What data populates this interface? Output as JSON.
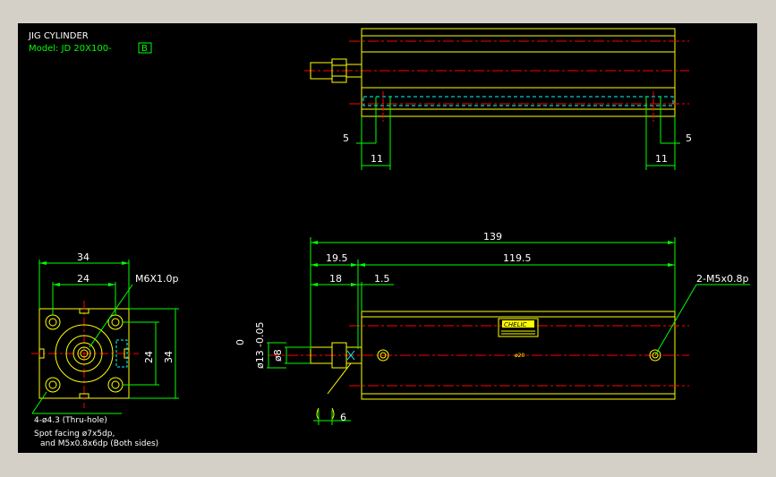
{
  "title_block": {
    "title": "JIG CYLINDER",
    "model_prefix": "Model: JD 20X100-",
    "model_suffix": "B"
  },
  "top_view": {
    "dim_left_5": "5",
    "dim_left_11": "11",
    "dim_right_5": "5",
    "dim_right_11": "11"
  },
  "front_view": {
    "dim_139": "139",
    "dim_19_5": "19.5",
    "dim_119_5": "119.5",
    "dim_18": "18",
    "dim_1_5": "1.5",
    "dim_6": "6",
    "dia_8": "ø8",
    "dia_13": "ø13",
    "tol_upper": "0",
    "tol_lower": "-0.05",
    "port_label": "2-M5x0.8p",
    "brand_label": "CHELIC",
    "marking": "ø20"
  },
  "side_view": {
    "dim_34_top": "34",
    "dim_24_top": "24",
    "dim_24_side": "24",
    "dim_34_side": "34",
    "thread_label": "M6X1.0p",
    "hole_label": "4-ø4.3 (Thru-hole)",
    "spot_line1": "Spot facing ø7x5dp,",
    "spot_line2": "and M5x0.8x6dp (Both sides)"
  },
  "colors": {
    "frame": "#d4d0c8",
    "background": "#000000",
    "outline": "#ffff00",
    "dimension": "#00ff00",
    "centerline": "#ff0000",
    "hidden": "#00ffff",
    "text": "#ffffff"
  }
}
